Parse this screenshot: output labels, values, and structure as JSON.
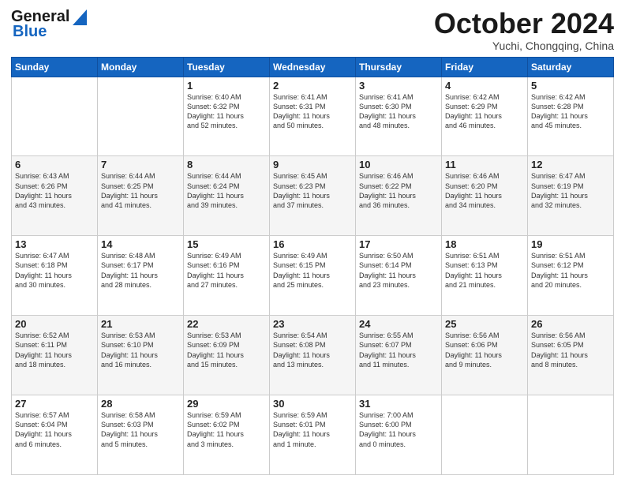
{
  "header": {
    "logo_line1": "General",
    "logo_line2": "Blue",
    "month": "October 2024",
    "location": "Yuchi, Chongqing, China"
  },
  "weekdays": [
    "Sunday",
    "Monday",
    "Tuesday",
    "Wednesday",
    "Thursday",
    "Friday",
    "Saturday"
  ],
  "weeks": [
    [
      {
        "day": "",
        "info": ""
      },
      {
        "day": "",
        "info": ""
      },
      {
        "day": "1",
        "info": "Sunrise: 6:40 AM\nSunset: 6:32 PM\nDaylight: 11 hours\nand 52 minutes."
      },
      {
        "day": "2",
        "info": "Sunrise: 6:41 AM\nSunset: 6:31 PM\nDaylight: 11 hours\nand 50 minutes."
      },
      {
        "day": "3",
        "info": "Sunrise: 6:41 AM\nSunset: 6:30 PM\nDaylight: 11 hours\nand 48 minutes."
      },
      {
        "day": "4",
        "info": "Sunrise: 6:42 AM\nSunset: 6:29 PM\nDaylight: 11 hours\nand 46 minutes."
      },
      {
        "day": "5",
        "info": "Sunrise: 6:42 AM\nSunset: 6:28 PM\nDaylight: 11 hours\nand 45 minutes."
      }
    ],
    [
      {
        "day": "6",
        "info": "Sunrise: 6:43 AM\nSunset: 6:26 PM\nDaylight: 11 hours\nand 43 minutes."
      },
      {
        "day": "7",
        "info": "Sunrise: 6:44 AM\nSunset: 6:25 PM\nDaylight: 11 hours\nand 41 minutes."
      },
      {
        "day": "8",
        "info": "Sunrise: 6:44 AM\nSunset: 6:24 PM\nDaylight: 11 hours\nand 39 minutes."
      },
      {
        "day": "9",
        "info": "Sunrise: 6:45 AM\nSunset: 6:23 PM\nDaylight: 11 hours\nand 37 minutes."
      },
      {
        "day": "10",
        "info": "Sunrise: 6:46 AM\nSunset: 6:22 PM\nDaylight: 11 hours\nand 36 minutes."
      },
      {
        "day": "11",
        "info": "Sunrise: 6:46 AM\nSunset: 6:20 PM\nDaylight: 11 hours\nand 34 minutes."
      },
      {
        "day": "12",
        "info": "Sunrise: 6:47 AM\nSunset: 6:19 PM\nDaylight: 11 hours\nand 32 minutes."
      }
    ],
    [
      {
        "day": "13",
        "info": "Sunrise: 6:47 AM\nSunset: 6:18 PM\nDaylight: 11 hours\nand 30 minutes."
      },
      {
        "day": "14",
        "info": "Sunrise: 6:48 AM\nSunset: 6:17 PM\nDaylight: 11 hours\nand 28 minutes."
      },
      {
        "day": "15",
        "info": "Sunrise: 6:49 AM\nSunset: 6:16 PM\nDaylight: 11 hours\nand 27 minutes."
      },
      {
        "day": "16",
        "info": "Sunrise: 6:49 AM\nSunset: 6:15 PM\nDaylight: 11 hours\nand 25 minutes."
      },
      {
        "day": "17",
        "info": "Sunrise: 6:50 AM\nSunset: 6:14 PM\nDaylight: 11 hours\nand 23 minutes."
      },
      {
        "day": "18",
        "info": "Sunrise: 6:51 AM\nSunset: 6:13 PM\nDaylight: 11 hours\nand 21 minutes."
      },
      {
        "day": "19",
        "info": "Sunrise: 6:51 AM\nSunset: 6:12 PM\nDaylight: 11 hours\nand 20 minutes."
      }
    ],
    [
      {
        "day": "20",
        "info": "Sunrise: 6:52 AM\nSunset: 6:11 PM\nDaylight: 11 hours\nand 18 minutes."
      },
      {
        "day": "21",
        "info": "Sunrise: 6:53 AM\nSunset: 6:10 PM\nDaylight: 11 hours\nand 16 minutes."
      },
      {
        "day": "22",
        "info": "Sunrise: 6:53 AM\nSunset: 6:09 PM\nDaylight: 11 hours\nand 15 minutes."
      },
      {
        "day": "23",
        "info": "Sunrise: 6:54 AM\nSunset: 6:08 PM\nDaylight: 11 hours\nand 13 minutes."
      },
      {
        "day": "24",
        "info": "Sunrise: 6:55 AM\nSunset: 6:07 PM\nDaylight: 11 hours\nand 11 minutes."
      },
      {
        "day": "25",
        "info": "Sunrise: 6:56 AM\nSunset: 6:06 PM\nDaylight: 11 hours\nand 9 minutes."
      },
      {
        "day": "26",
        "info": "Sunrise: 6:56 AM\nSunset: 6:05 PM\nDaylight: 11 hours\nand 8 minutes."
      }
    ],
    [
      {
        "day": "27",
        "info": "Sunrise: 6:57 AM\nSunset: 6:04 PM\nDaylight: 11 hours\nand 6 minutes."
      },
      {
        "day": "28",
        "info": "Sunrise: 6:58 AM\nSunset: 6:03 PM\nDaylight: 11 hours\nand 5 minutes."
      },
      {
        "day": "29",
        "info": "Sunrise: 6:59 AM\nSunset: 6:02 PM\nDaylight: 11 hours\nand 3 minutes."
      },
      {
        "day": "30",
        "info": "Sunrise: 6:59 AM\nSunset: 6:01 PM\nDaylight: 11 hours\nand 1 minute."
      },
      {
        "day": "31",
        "info": "Sunrise: 7:00 AM\nSunset: 6:00 PM\nDaylight: 11 hours\nand 0 minutes."
      },
      {
        "day": "",
        "info": ""
      },
      {
        "day": "",
        "info": ""
      }
    ]
  ]
}
